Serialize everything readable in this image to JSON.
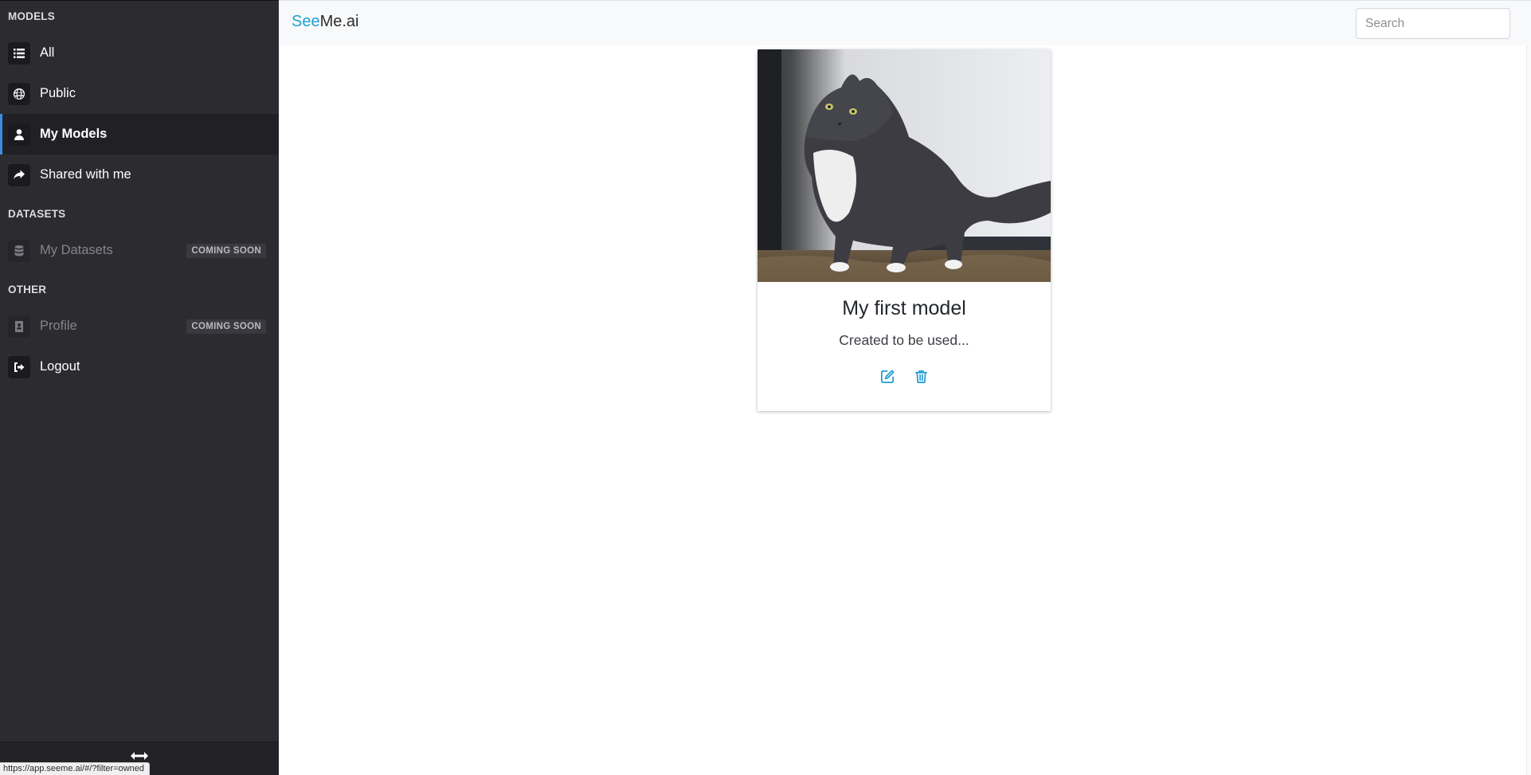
{
  "brand": {
    "see": "See",
    "rest": "Me.ai"
  },
  "search": {
    "placeholder": "Search",
    "value": ""
  },
  "sidebar": {
    "sections": [
      {
        "title": "MODELS"
      },
      {
        "title": "DATASETS"
      },
      {
        "title": "OTHER"
      }
    ],
    "items": [
      {
        "label": "All",
        "icon": "list-icon"
      },
      {
        "label": "Public",
        "icon": "globe-icon"
      },
      {
        "label": "My Models",
        "icon": "user-icon",
        "active": true
      },
      {
        "label": "Shared with me",
        "icon": "share-icon"
      },
      {
        "label": "My Datasets",
        "icon": "database-icon",
        "badge": "COMING SOON",
        "disabled": true
      },
      {
        "label": "Profile",
        "icon": "id-card-icon",
        "badge": "COMING SOON",
        "disabled": true
      },
      {
        "label": "Logout",
        "icon": "sign-out-icon"
      }
    ]
  },
  "status_bar": {
    "url": "https://app.seeme.ai/#/?filter=owned"
  },
  "model_card": {
    "title": "My first model",
    "description": "Created to be used...",
    "image_alt": "cat-photo",
    "actions": [
      {
        "icon": "edit-icon"
      },
      {
        "icon": "trash-icon"
      }
    ]
  },
  "colors": {
    "sidebar_bg": "#2b2b30",
    "accent": "#20a1d3",
    "active_indicator": "#3a8ee6"
  }
}
